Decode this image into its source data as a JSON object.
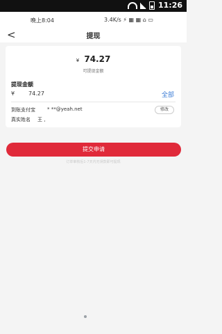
{
  "system_status": {
    "time": "11:26"
  },
  "app_status": {
    "left_text": "晚上8:04",
    "right_text": "3.4K/s ⚡ ▦ ▦ ⌂ ▭"
  },
  "header": {
    "back_glyph": "<",
    "title": "提现"
  },
  "amount": {
    "currency": "¥",
    "value": "74.27",
    "caption": "可提现金额"
  },
  "withdraw": {
    "label": "提现金额",
    "currency": "¥",
    "input_value": "74.27",
    "all_label": "全部"
  },
  "account": {
    "label": "到账支付宝",
    "value": "*   **@yeah.net",
    "edit_label": "修改"
  },
  "realname": {
    "label": "真实姓名",
    "value": "王 ,"
  },
  "submit": {
    "label": "提交申请"
  },
  "hint": {
    "text": "订单审核后1-7天内无误款即可提现"
  }
}
